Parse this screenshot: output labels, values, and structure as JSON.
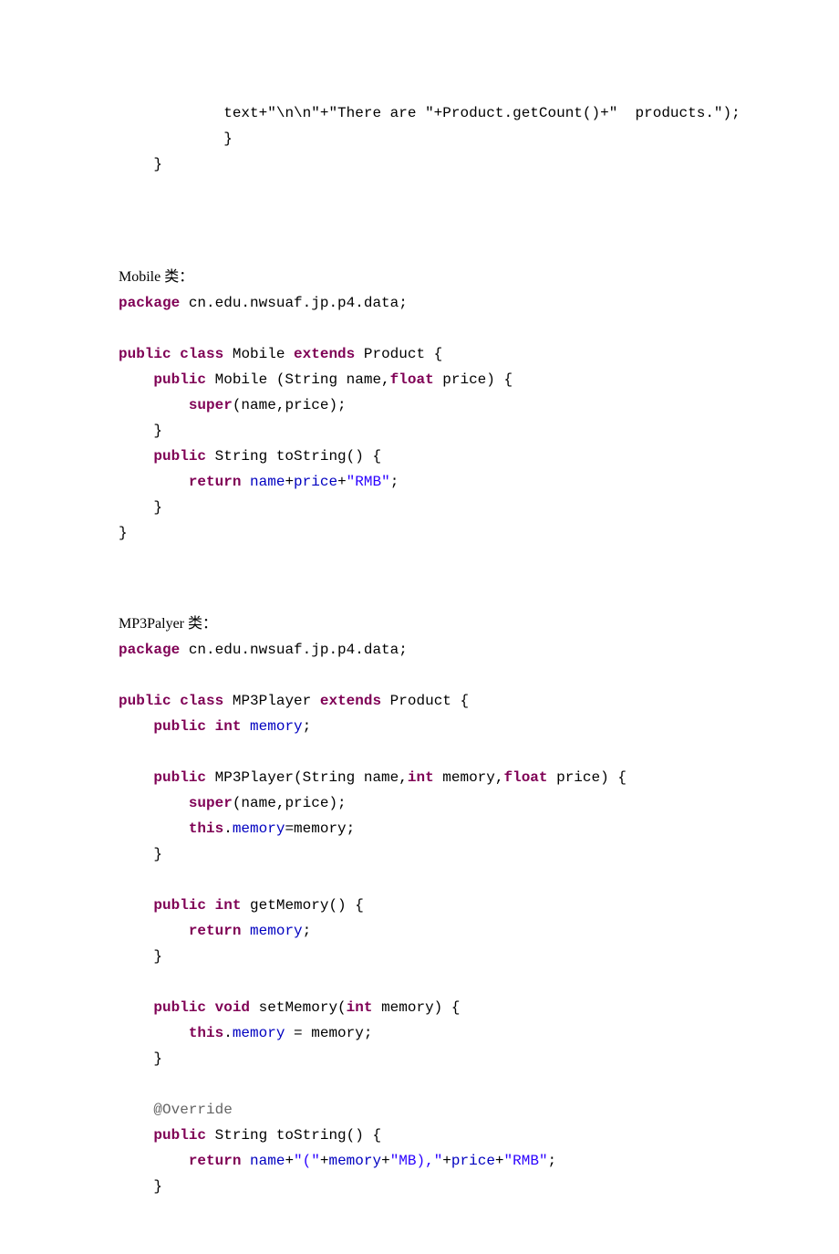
{
  "top_snippet": {
    "line1_a": "text+",
    "line1_b": "\"\\n\\n\"",
    "line1_c": "+",
    "line1_d": "\"There are \"",
    "line1_e": "+Product.getCount()+",
    "line1_f": "\"  products.\"",
    "line1_g": ");",
    "line2": "}",
    "line3": "}"
  },
  "mobile": {
    "label": "Mobile 类：",
    "pkg_kw": "package",
    "pkg_val": " cn.edu.nwsuaf.jp.p4.data;",
    "decl_public": "public",
    "decl_class": "class",
    "decl_name": " Mobile ",
    "decl_extends": "extends",
    "decl_parent": " Product {",
    "ctor_public": "public",
    "ctor_sig_a": " Mobile (String name,",
    "ctor_sig_float": "float",
    "ctor_sig_b": " price) {",
    "ctor_super": "super",
    "ctor_super_args": "(name,price);",
    "ctor_close": "}",
    "ts_public": "public",
    "ts_sig": " String toString() {",
    "ts_return": "return",
    "ts_name": "name",
    "ts_plus1": "+",
    "ts_price": "price",
    "ts_plus2": "+",
    "ts_str": "\"RMB\"",
    "ts_semi": ";",
    "ts_close": "}",
    "class_close": "}"
  },
  "mp3": {
    "label": "MP3Palyer 类：",
    "pkg_kw": "package",
    "pkg_val": " cn.edu.nwsuaf.jp.p4.data;",
    "decl_public": "public",
    "decl_class": "class",
    "decl_name": " MP3Player ",
    "decl_extends": "extends",
    "decl_parent": " Product {",
    "fld_public": "public",
    "fld_int": "int",
    "fld_name": "memory",
    "fld_semi": ";",
    "ctor_public": "public",
    "ctor_sig_a": " MP3Player(String name,",
    "ctor_int": "int",
    "ctor_sig_b": " memory,",
    "ctor_float": "float",
    "ctor_sig_c": " price) {",
    "ctor_super": "super",
    "ctor_super_args": "(name,price);",
    "ctor_this": "this",
    "ctor_dot": ".",
    "ctor_mem_l": "memory",
    "ctor_eq": "=memory;",
    "ctor_close": "}",
    "gm_public": "public",
    "gm_int": "int",
    "gm_sig": " getMemory() {",
    "gm_return": "return",
    "gm_mem": "memory",
    "gm_semi": ";",
    "gm_close": "}",
    "sm_public": "public",
    "sm_void": "void",
    "sm_sig_a": " setMemory(",
    "sm_int": "int",
    "sm_sig_b": " memory) {",
    "sm_this": "this",
    "sm_dot": ".",
    "sm_mem": "memory",
    "sm_eq": " = memory;",
    "sm_close": "}",
    "ann": "@Override",
    "ts_public": "public",
    "ts_sig": " String toString() {",
    "ts_return": "return",
    "ts_name": "name",
    "ts_p1": "+",
    "ts_s1": "\"(\"",
    "ts_p2": "+",
    "ts_mem": "memory",
    "ts_p3": "+",
    "ts_s2": "\"MB),\"",
    "ts_p4": "+",
    "ts_price": "price",
    "ts_p5": "+",
    "ts_s3": "\"RMB\"",
    "ts_semi": ";",
    "ts_close": "}"
  }
}
